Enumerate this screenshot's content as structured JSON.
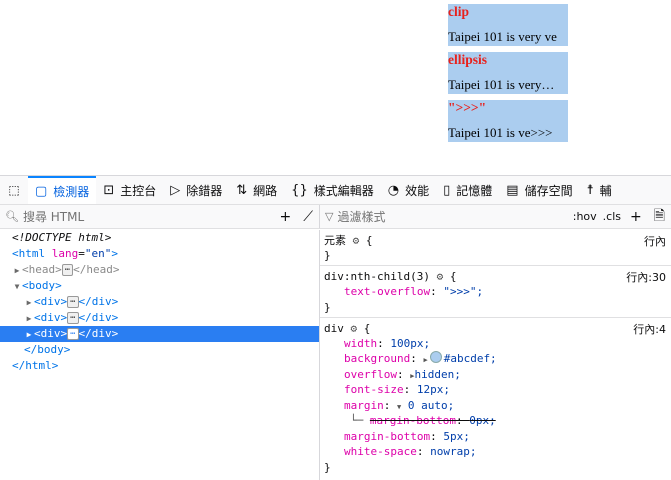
{
  "page": {
    "boxes": [
      {
        "heading": "clip",
        "text": "Taipei 101 is very ve"
      },
      {
        "heading": "ellipsis",
        "text": "Taipei 101 is very…"
      },
      {
        "heading": "\">>>\"",
        "text": "Taipei 101 is ve>>>"
      }
    ]
  },
  "devtools": {
    "tabs": [
      {
        "label": "檢測器",
        "icon": "inspector-icon"
      },
      {
        "label": "主控台",
        "icon": "console-icon"
      },
      {
        "label": "除錯器",
        "icon": "debugger-icon"
      },
      {
        "label": "網路",
        "icon": "network-icon"
      },
      {
        "label": "樣式編輯器",
        "icon": "style-editor-icon"
      },
      {
        "label": "效能",
        "icon": "performance-icon"
      },
      {
        "label": "記憶體",
        "icon": "memory-icon"
      },
      {
        "label": "儲存空間",
        "icon": "storage-icon"
      },
      {
        "label": "輔",
        "icon": "accessibility-icon"
      }
    ],
    "search_placeholder": "搜尋 HTML",
    "filter_placeholder": "過濾樣式",
    "hov": ":hov",
    "cls": ".cls",
    "markup": {
      "doctype": "<!DOCTYPE html>",
      "html_open_tag": "<html",
      "html_attr": "lang",
      "html_attr_eq": "=",
      "html_attr_val": "\"en\"",
      "html_close_bracket": ">",
      "head_open": "<head>",
      "head_close": "</head>",
      "body_open": "<body>",
      "body_close": "</body>",
      "html_close": "</html>",
      "div_open": "<div>",
      "div_close": "</div>",
      "ellipsis": "⋯"
    },
    "rules": [
      {
        "selector": "元素",
        "open": "{",
        "close": "}",
        "source": "行內"
      },
      {
        "selector": "div:nth-child(3)",
        "open": "{",
        "close": "}",
        "source": "行內:30",
        "decls": [
          {
            "prop": "text-overflow",
            "value": "\">>>\";"
          }
        ]
      },
      {
        "selector": "div",
        "open": "{",
        "close": "}",
        "source": "行內:4",
        "decls": [
          {
            "prop": "width",
            "value": "100px;"
          },
          {
            "prop": "background",
            "value": "#abcdef;"
          },
          {
            "prop": "overflow",
            "value": "hidden;"
          },
          {
            "prop": "font-size",
            "value": "12px;"
          },
          {
            "prop": "margin",
            "value": "0 auto;"
          },
          {
            "prop": "margin-bottom",
            "value": "0px;",
            "overridden": true
          },
          {
            "prop": "margin-bottom",
            "value": "5px;"
          },
          {
            "prop": "white-space",
            "value": "nowrap;"
          }
        ]
      }
    ]
  }
}
